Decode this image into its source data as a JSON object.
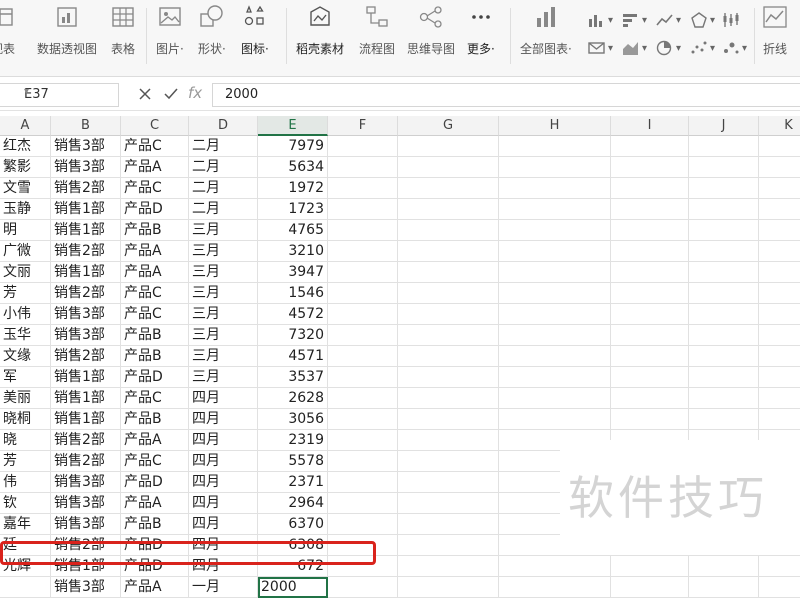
{
  "ribbon": {
    "items": [
      {
        "label": "视表"
      },
      {
        "label": "数据透视图"
      },
      {
        "label": "表格"
      },
      {
        "label": "图片·"
      },
      {
        "label": "形状·"
      },
      {
        "label": "图标·"
      },
      {
        "label": "稻壳素材"
      },
      {
        "label": "流程图"
      },
      {
        "label": "思维导图"
      },
      {
        "label": "更多·"
      },
      {
        "label": "全部图表·"
      },
      {
        "label": "折线"
      }
    ]
  },
  "formula_bar": {
    "name_box": "E37",
    "fx_label": "fx",
    "value": "2000"
  },
  "columns": [
    "A",
    "B",
    "C",
    "D",
    "E",
    "F",
    "G",
    "H",
    "I",
    "J",
    "K"
  ],
  "rows": [
    {
      "a": "红杰",
      "b": "销售3部",
      "c": "产品C",
      "d": "二月",
      "e": "7979"
    },
    {
      "a": "繁影",
      "b": "销售3部",
      "c": "产品A",
      "d": "二月",
      "e": "5634"
    },
    {
      "a": "文雪",
      "b": "销售2部",
      "c": "产品C",
      "d": "二月",
      "e": "1972"
    },
    {
      "a": "玉静",
      "b": "销售1部",
      "c": "产品D",
      "d": "二月",
      "e": "1723"
    },
    {
      "a": "明",
      "b": "销售1部",
      "c": "产品B",
      "d": "三月",
      "e": "4765"
    },
    {
      "a": "广微",
      "b": "销售2部",
      "c": "产品A",
      "d": "三月",
      "e": "3210"
    },
    {
      "a": "文丽",
      "b": "销售1部",
      "c": "产品A",
      "d": "三月",
      "e": "3947"
    },
    {
      "a": "芳",
      "b": "销售2部",
      "c": "产品C",
      "d": "三月",
      "e": "1546"
    },
    {
      "a": "小伟",
      "b": "销售3部",
      "c": "产品C",
      "d": "三月",
      "e": "4572"
    },
    {
      "a": "玉华",
      "b": "销售3部",
      "c": "产品B",
      "d": "三月",
      "e": "7320"
    },
    {
      "a": "文缘",
      "b": "销售2部",
      "c": "产品B",
      "d": "三月",
      "e": "4571"
    },
    {
      "a": "军",
      "b": "销售1部",
      "c": "产品D",
      "d": "三月",
      "e": "3537"
    },
    {
      "a": "美丽",
      "b": "销售1部",
      "c": "产品C",
      "d": "四月",
      "e": "2628"
    },
    {
      "a": "晓桐",
      "b": "销售1部",
      "c": "产品B",
      "d": "四月",
      "e": "3056"
    },
    {
      "a": "晓",
      "b": "销售2部",
      "c": "产品A",
      "d": "四月",
      "e": "2319"
    },
    {
      "a": "芳",
      "b": "销售2部",
      "c": "产品C",
      "d": "四月",
      "e": "5578"
    },
    {
      "a": "伟",
      "b": "销售3部",
      "c": "产品D",
      "d": "四月",
      "e": "2371"
    },
    {
      "a": "钦",
      "b": "销售3部",
      "c": "产品A",
      "d": "四月",
      "e": "2964"
    },
    {
      "a": "嘉年",
      "b": "销售3部",
      "c": "产品B",
      "d": "四月",
      "e": "6370"
    },
    {
      "a": "廷",
      "b": "销售2部",
      "c": "产品D",
      "d": "四月",
      "e": "6308"
    },
    {
      "a": "光辉",
      "b": "销售1部",
      "c": "产品D",
      "d": "四月",
      "e": "672"
    },
    {
      "a": "",
      "b": "销售3部",
      "c": "产品A",
      "d": "一月",
      "e": "2000"
    }
  ],
  "watermark": "软件技巧",
  "colors": {
    "accent": "#217346",
    "highlight": "#d9231c"
  }
}
